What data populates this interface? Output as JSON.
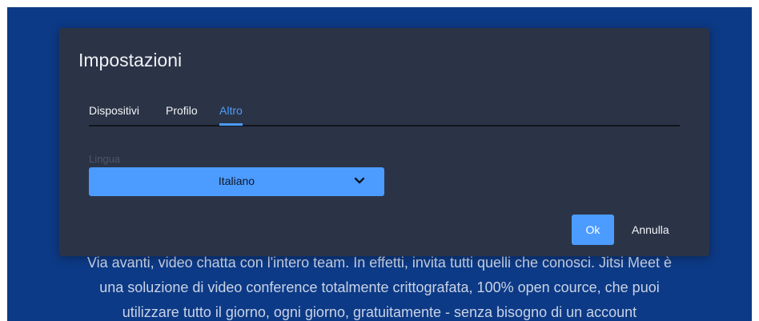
{
  "background": {
    "lines": [
      "Via avanti, video chatta con l'intero team. In effetti, invita tutti quelli che conosci. Jitsi Meet è",
      "una soluzione di video conference totalmente crittografata, 100% open cource, che puoi",
      "utilizzare tutto il giorno, ogni giorno, gratuitamente - senza bisogno di un account"
    ]
  },
  "dialog": {
    "title": "Impostazioni",
    "tabs": [
      {
        "label": "Dispositivi",
        "active": false
      },
      {
        "label": "Profilo",
        "active": false
      },
      {
        "label": "Altro",
        "active": true
      }
    ],
    "language": {
      "label": "Lingua",
      "selected": "Italiano",
      "icon": "chevron-down-icon"
    },
    "ok_label": "Ok",
    "cancel_label": "Annulla"
  },
  "colors": {
    "page_background": "#0d3a86",
    "dialog_background": "#2b3446",
    "accent": "#4c9cff"
  }
}
